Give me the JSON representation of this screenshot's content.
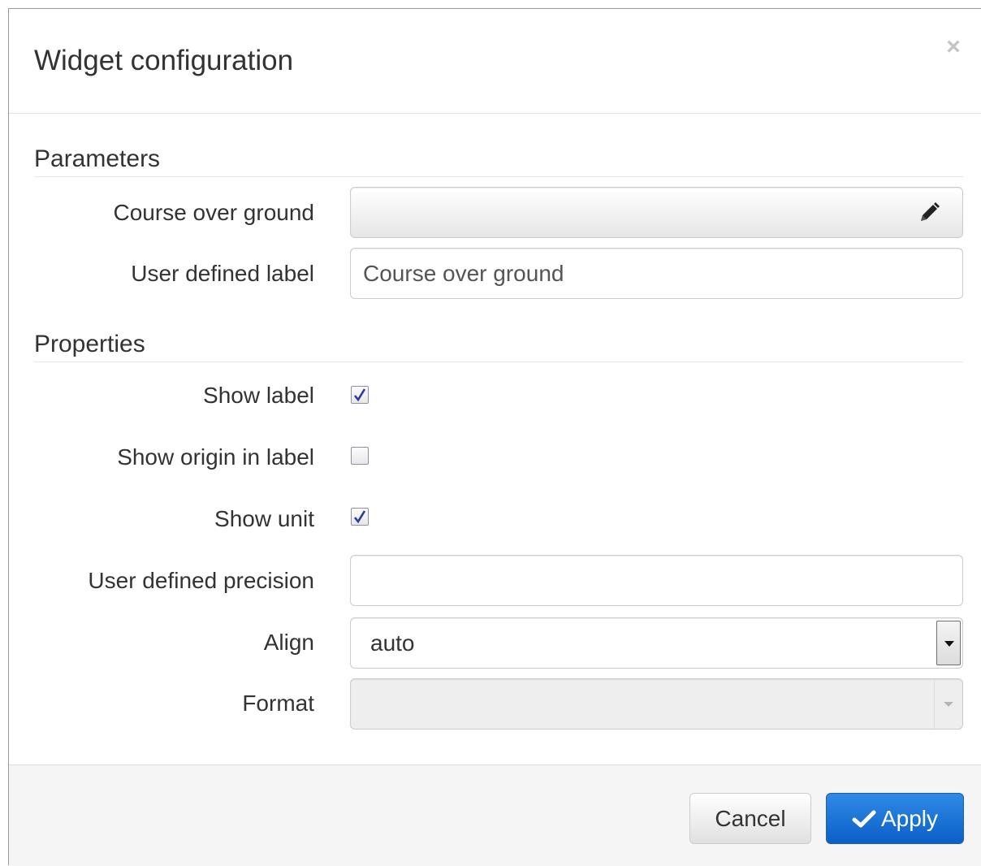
{
  "dialog": {
    "title": "Widget configuration",
    "close_glyph": "×"
  },
  "parameters": {
    "section_title": "Parameters",
    "course_label": "Course over ground",
    "course_value": "",
    "course_icon": "pencil-icon",
    "user_label_label": "User defined label",
    "user_label_value": "Course over ground"
  },
  "properties": {
    "section_title": "Properties",
    "show_label": {
      "label": "Show label",
      "checked": true
    },
    "show_origin": {
      "label": "Show origin in label",
      "checked": false
    },
    "show_unit": {
      "label": "Show unit",
      "checked": true
    },
    "precision": {
      "label": "User defined precision",
      "value": ""
    },
    "align": {
      "label": "Align",
      "value": "auto"
    },
    "format": {
      "label": "Format",
      "value": "",
      "disabled": true
    }
  },
  "footer": {
    "cancel_label": "Cancel",
    "apply_label": "Apply",
    "apply_icon": "check-icon"
  },
  "colors": {
    "primary": "#0b5fc8",
    "checkmark": "#2a3c9c"
  }
}
